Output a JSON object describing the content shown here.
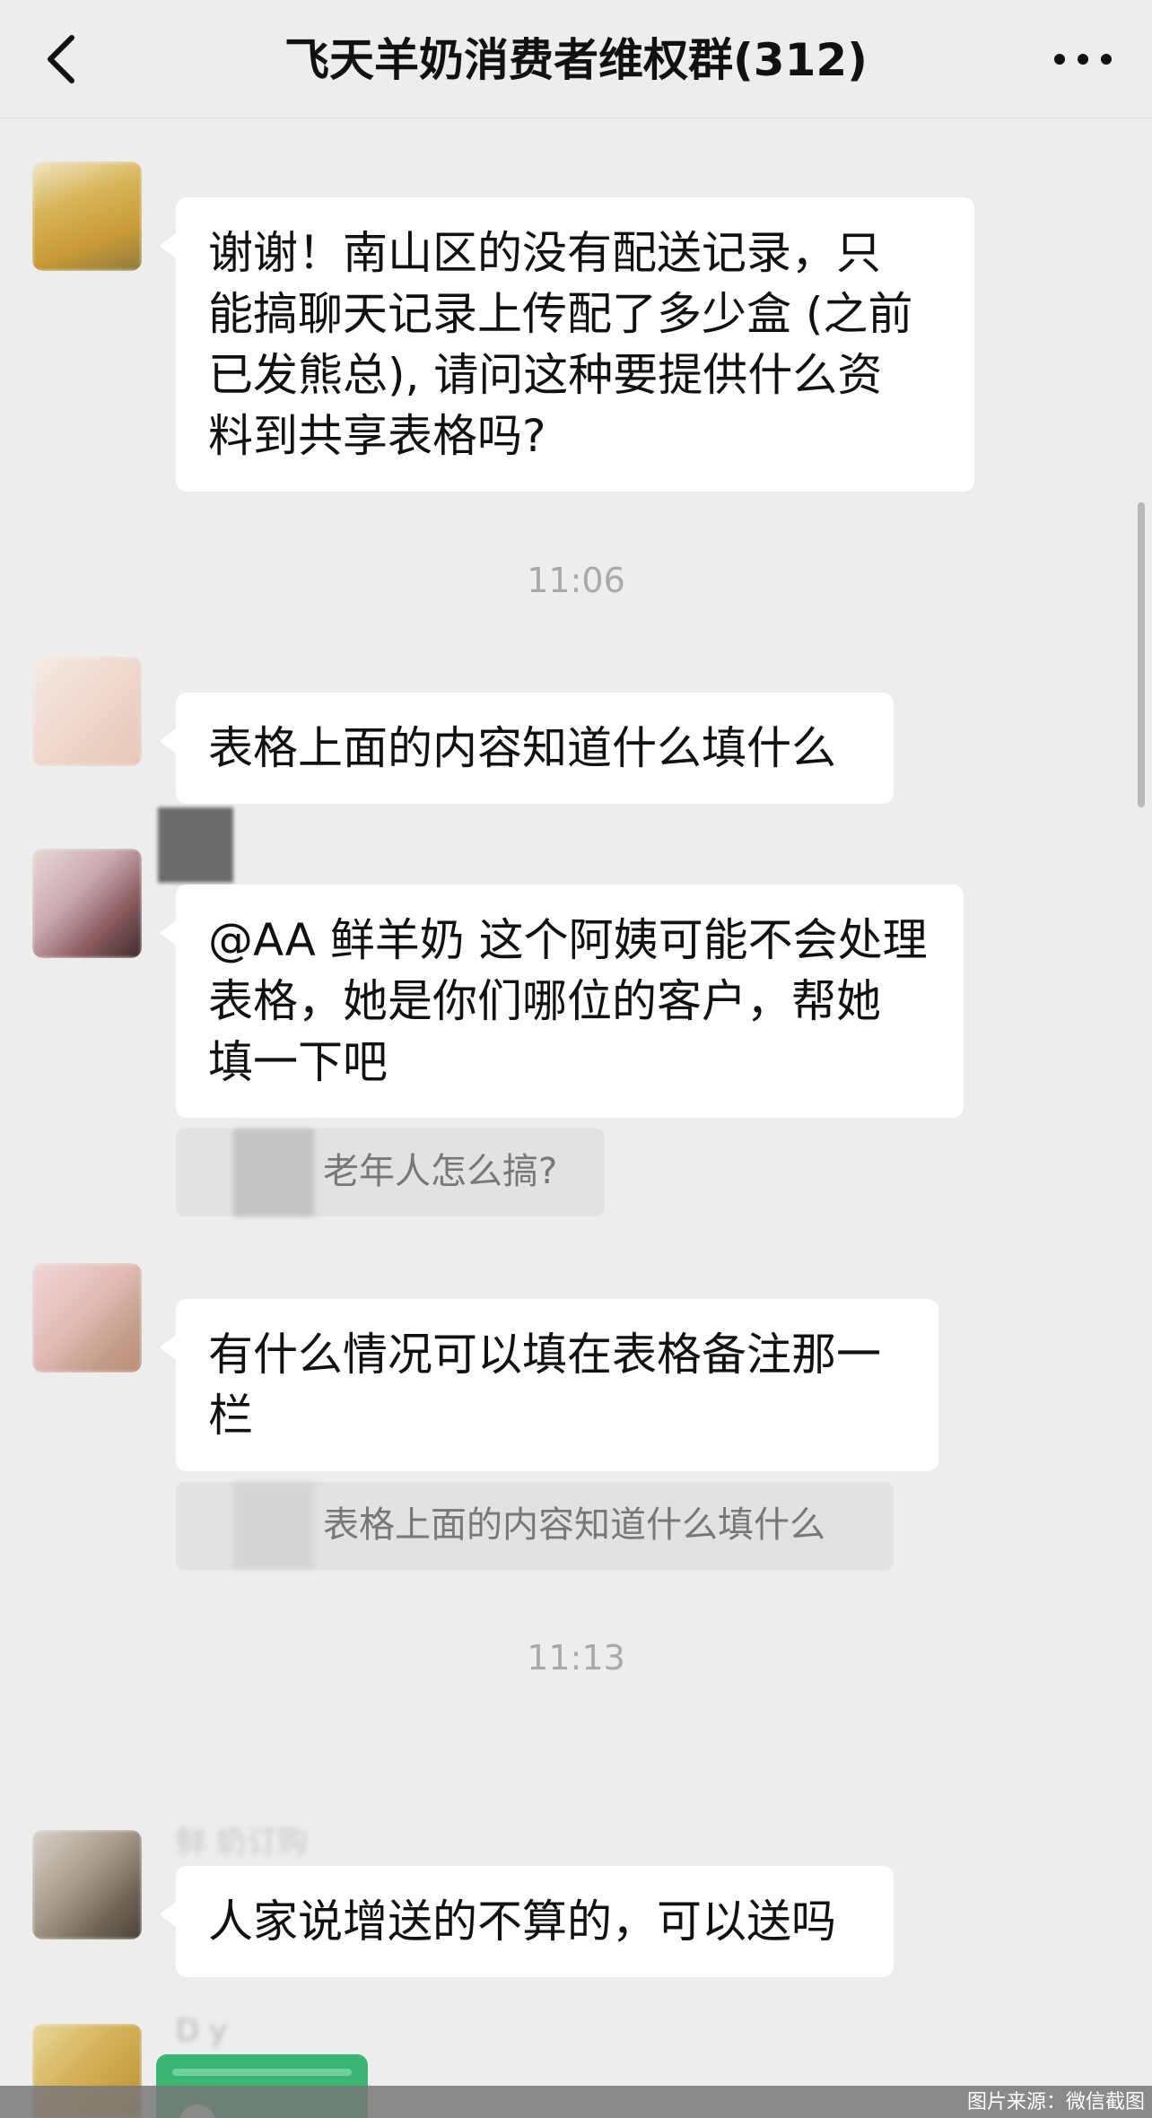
{
  "header": {
    "title": "飞天羊奶消费者维权群(312)",
    "back_icon": "chevron-left-icon",
    "more_icon": "more-dots-icon"
  },
  "messages": [
    {
      "lines": [
        "谢谢！南山区的没有配送记录，只",
        "能搞聊天记录上传配了多少盒 (之前",
        "已发熊总), 请问这种要提供什么资",
        "料到共享表格吗?"
      ]
    },
    {
      "lines": [
        "表格上面的内容知道什么填什么"
      ]
    },
    {
      "lines": [
        "@AA 鲜羊奶 这个阿姨可能不会处理",
        "表格，她是你们哪位的客户，帮她",
        "填一下吧"
      ],
      "quote": "老年人怎么搞?"
    },
    {
      "lines": [
        "有什么情况可以填在表格备注那一",
        "栏"
      ],
      "quote": "表格上面的内容知道什么填什么"
    },
    {
      "sender": "鲜  奶订购",
      "lines": [
        "人家说增送的不算的，可以送吗"
      ]
    },
    {
      "sender": "D y"
    }
  ],
  "timestamps": [
    "11:06",
    "11:13"
  ],
  "footer": {
    "credit": "图片来源：微信截图"
  },
  "colors": {
    "background": "#ededed",
    "bubble": "#ffffff",
    "quote_bg": "#e2e2e2",
    "accent_green": "#39b574"
  }
}
